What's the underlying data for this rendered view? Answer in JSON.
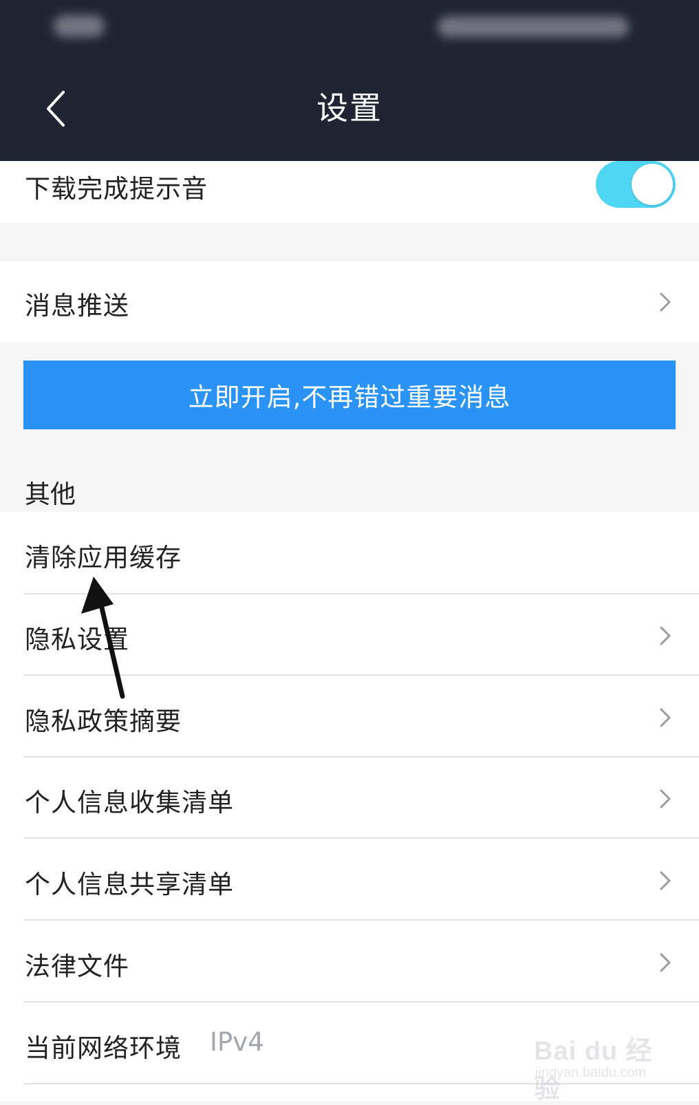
{
  "header": {
    "title": "设置",
    "back_icon": "chevron-left-icon"
  },
  "colors": {
    "header_bg": "#212533",
    "toggle_on": "#4fd6f3",
    "cta_bg": "#2b93f5",
    "secondary_text": "#a2a5ab"
  },
  "settings": {
    "download_sound": {
      "label": "下载完成提示音",
      "enabled": true
    },
    "push": {
      "label": "消息推送"
    },
    "cta": {
      "label": "立即开启,不再错过重要消息"
    }
  },
  "other": {
    "section_title": "其他",
    "items": [
      {
        "label": "清除应用缓存"
      },
      {
        "label": "隐私设置"
      },
      {
        "label": "隐私政策摘要"
      },
      {
        "label": "个人信息收集清单"
      },
      {
        "label": "个人信息共享清单"
      },
      {
        "label": "法律文件"
      },
      {
        "label": "当前网络环境",
        "value": "IPv4"
      }
    ]
  },
  "watermark": {
    "logo": "Bai du 经验",
    "url": "jingyan.baidu.com"
  }
}
